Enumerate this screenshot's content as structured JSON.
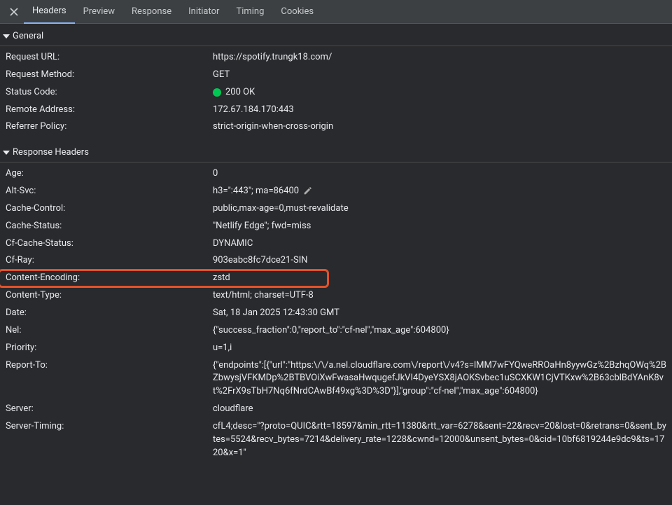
{
  "tabs": {
    "headers": "Headers",
    "preview": "Preview",
    "response": "Response",
    "initiator": "Initiator",
    "timing": "Timing",
    "cookies": "Cookies"
  },
  "sections": {
    "general": {
      "title": "General",
      "rows": [
        {
          "k": "Request URL:",
          "v": "https://spotify.trungk18.com/"
        },
        {
          "k": "Request Method:",
          "v": "GET"
        },
        {
          "k": "Status Code:",
          "v": "200 OK",
          "status_dot": true
        },
        {
          "k": "Remote Address:",
          "v": "172.67.184.170:443"
        },
        {
          "k": "Referrer Policy:",
          "v": "strict-origin-when-cross-origin"
        }
      ]
    },
    "response_headers": {
      "title": "Response Headers",
      "rows": [
        {
          "k": "Age:",
          "v": "0"
        },
        {
          "k": "Alt-Svc:",
          "v": "h3=\":443\"; ma=86400",
          "editable": true
        },
        {
          "k": "Cache-Control:",
          "v": "public,max-age=0,must-revalidate"
        },
        {
          "k": "Cache-Status:",
          "v": "\"Netlify Edge\"; fwd=miss"
        },
        {
          "k": "Cf-Cache-Status:",
          "v": "DYNAMIC"
        },
        {
          "k": "Cf-Ray:",
          "v": "903eabc8fc7dce21-SIN"
        },
        {
          "k": "Content-Encoding:",
          "v": "zstd",
          "highlight": true
        },
        {
          "k": "Content-Type:",
          "v": "text/html; charset=UTF-8"
        },
        {
          "k": "Date:",
          "v": "Sat, 18 Jan 2025 12:43:30 GMT"
        },
        {
          "k": "Nel:",
          "v": "{\"success_fraction\":0,\"report_to\":\"cf-nel\",\"max_age\":604800}"
        },
        {
          "k": "Priority:",
          "v": "u=1,i"
        },
        {
          "k": "Report-To:",
          "v": "{\"endpoints\":[{\"url\":\"https:\\/\\/a.nel.cloudflare.com\\/report\\/v4?s=lMM7wFYQweRROaHn8yywGz%2BzhqOWq%2BZbwysjVFKMDp%2BTBVOiXwFwasaHwqugefJkVI4DyeYSX8jAOKSvbec1uSCXKW1CjVTKxw%2B63cblBdYAnK8vt%2FrX9sTbH7Nq6fNrdCAwBf49xg%3D%3D\"}],\"group\":\"cf-nel\",\"max_age\":604800}"
        },
        {
          "k": "Server:",
          "v": "cloudflare"
        },
        {
          "k": "Server-Timing:",
          "v": "cfL4;desc=\"?proto=QUIC&rtt=18597&min_rtt=11380&rtt_var=6278&sent=22&recv=20&lost=0&retrans=0&sent_bytes=5524&recv_bytes=7214&delivery_rate=1228&cwnd=12000&unsent_bytes=0&cid=10bf6819244e9dc9&ts=1720&x=1\""
        }
      ]
    }
  }
}
